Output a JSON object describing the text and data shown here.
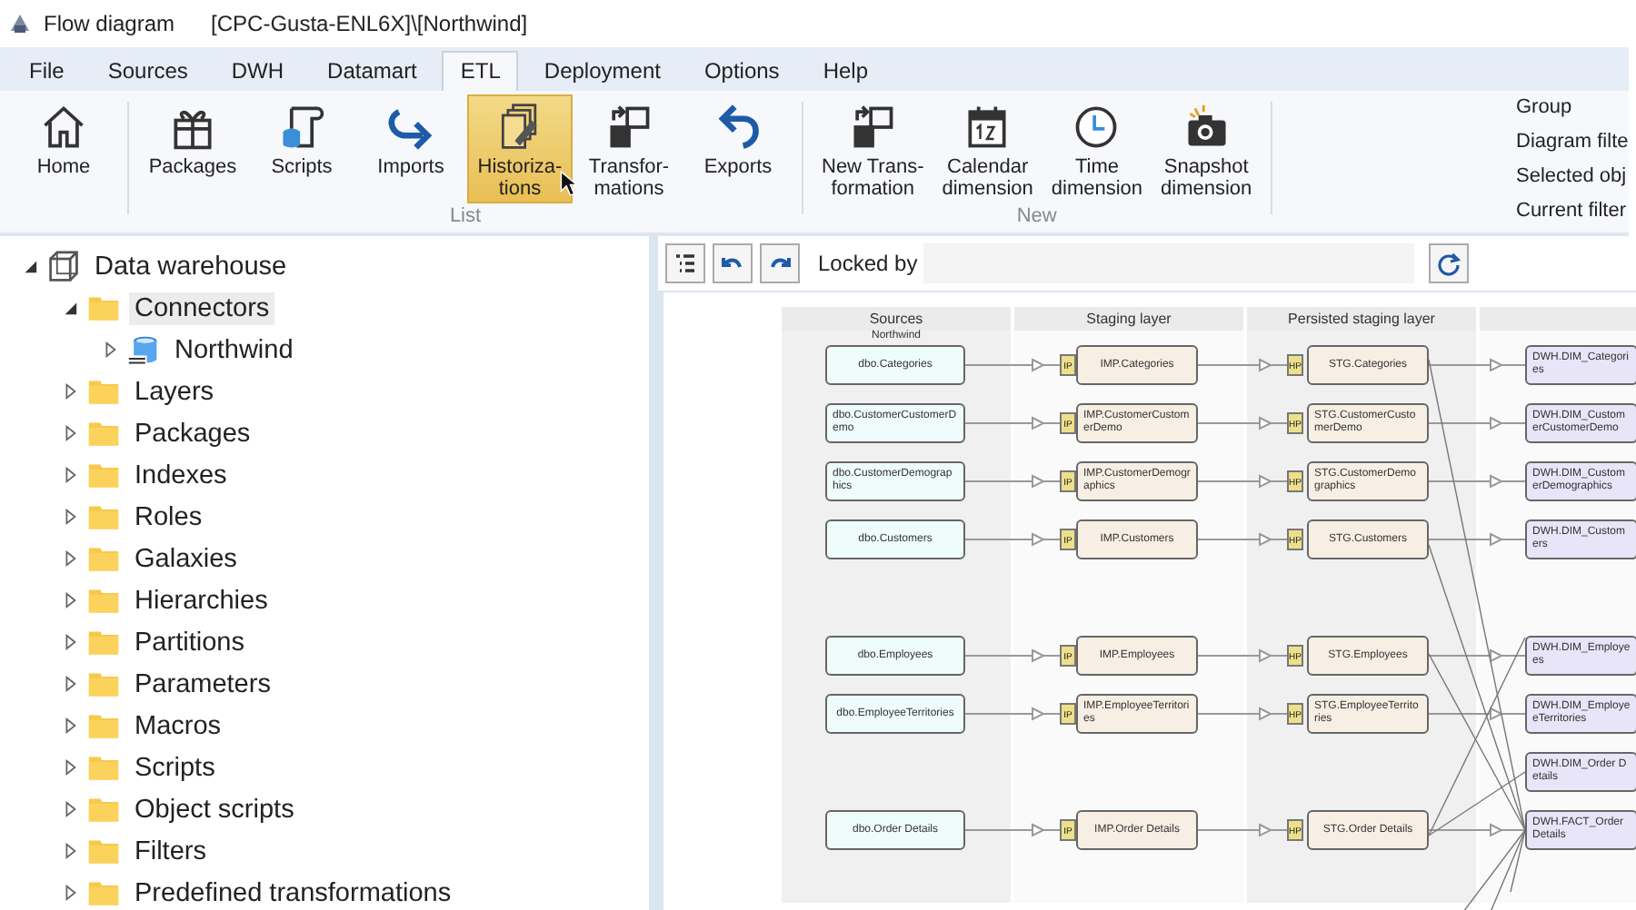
{
  "window": {
    "title": "Flow diagram",
    "path": "[CPC-Gusta-ENL6X]\\[Northwind]"
  },
  "menu": [
    {
      "label": "File",
      "selected": false
    },
    {
      "label": "Sources",
      "selected": false
    },
    {
      "label": "DWH",
      "selected": false
    },
    {
      "label": "Datamart",
      "selected": false
    },
    {
      "label": "ETL",
      "selected": true
    },
    {
      "label": "Deployment",
      "selected": false
    },
    {
      "label": "Options",
      "selected": false
    },
    {
      "label": "Help",
      "selected": false
    }
  ],
  "ribbon": {
    "groups": [
      {
        "buttons": [
          {
            "kind": "home",
            "lines": [
              "Home"
            ],
            "highlighted": false
          }
        ]
      },
      {
        "label": "List",
        "buttons": [
          {
            "kind": "packages",
            "lines": [
              "Packages"
            ],
            "highlighted": false
          },
          {
            "kind": "scripts",
            "lines": [
              "Scripts"
            ],
            "highlighted": false
          },
          {
            "kind": "imports",
            "lines": [
              "Imports"
            ],
            "highlighted": false
          },
          {
            "kind": "historizations",
            "lines": [
              "Historiza-",
              "tions"
            ],
            "highlighted": true
          },
          {
            "kind": "transformations",
            "lines": [
              "Transfor-",
              "mations"
            ],
            "highlighted": false
          },
          {
            "kind": "exports",
            "lines": [
              "Exports"
            ],
            "highlighted": false
          }
        ]
      },
      {
        "label": "New",
        "buttons": [
          {
            "kind": "transformations",
            "lines": [
              "New Trans-",
              "formation"
            ],
            "highlighted": false
          },
          {
            "kind": "calendar",
            "lines": [
              "Calendar",
              "dimension"
            ],
            "highlighted": false
          },
          {
            "kind": "time",
            "lines": [
              "Time",
              "dimension"
            ],
            "highlighted": false
          },
          {
            "kind": "snapshot",
            "lines": [
              "Snapshot",
              "dimension"
            ],
            "highlighted": false
          }
        ]
      }
    ],
    "options": [
      "Group",
      "Diagram filte",
      "Selected obj",
      "Current filter"
    ]
  },
  "tree": {
    "label": "Data warehouse",
    "kind": "warehouse",
    "expanded": true,
    "selected": false,
    "children": [
      {
        "label": "Connectors",
        "kind": "folder",
        "expanded": true,
        "selected": true,
        "children": [
          {
            "label": "Northwind",
            "kind": "database",
            "expanded": false,
            "selected": false
          }
        ]
      },
      {
        "label": "Layers",
        "kind": "folder",
        "expanded": false,
        "selected": false
      },
      {
        "label": "Packages",
        "kind": "folder",
        "expanded": false,
        "selected": false
      },
      {
        "label": "Indexes",
        "kind": "folder",
        "expanded": false,
        "selected": false
      },
      {
        "label": "Roles",
        "kind": "folder",
        "expanded": false,
        "selected": false
      },
      {
        "label": "Galaxies",
        "kind": "folder",
        "expanded": false,
        "selected": false
      },
      {
        "label": "Hierarchies",
        "kind": "folder",
        "expanded": false,
        "selected": false
      },
      {
        "label": "Partitions",
        "kind": "folder",
        "expanded": false,
        "selected": false
      },
      {
        "label": "Parameters",
        "kind": "folder",
        "expanded": false,
        "selected": false
      },
      {
        "label": "Macros",
        "kind": "folder",
        "expanded": false,
        "selected": false
      },
      {
        "label": "Scripts",
        "kind": "folder",
        "expanded": false,
        "selected": false
      },
      {
        "label": "Object scripts",
        "kind": "folder",
        "expanded": false,
        "selected": false
      },
      {
        "label": "Filters",
        "kind": "folder",
        "expanded": false,
        "selected": false
      },
      {
        "label": "Predefined transformations",
        "kind": "folder",
        "expanded": false,
        "selected": false
      }
    ]
  },
  "diagram_toolbar": {
    "locked_by_label": "Locked by"
  },
  "diagram": {
    "columns": [
      "Sources",
      "Staging layer",
      "Persisted staging layer"
    ],
    "source_group": "Northwind",
    "rows": [
      {
        "source": "dbo.Categories",
        "import_badge": "IP",
        "staging": "IMP.Categories",
        "hist_badge": "HP",
        "persisted": "STG.Categories",
        "target": "DWH.DIM_Categories"
      },
      {
        "source": "dbo.CustomerCustomerDemo",
        "import_badge": "IP",
        "staging": "IMP.CustomerCustomerDemo",
        "hist_badge": "HP",
        "persisted": "STG.CustomerCustomerDemo",
        "target": "DWH.DIM_CustomerCustomerDemo"
      },
      {
        "source": "dbo.CustomerDemographics",
        "import_badge": "IP",
        "staging": "IMP.CustomerDemographics",
        "hist_badge": "HP",
        "persisted": "STG.CustomerDemographics",
        "target": "DWH.DIM_CustomerDemographics"
      },
      {
        "source": "dbo.Customers",
        "import_badge": "IP",
        "staging": "IMP.Customers",
        "hist_badge": "HP",
        "persisted": "STG.Customers",
        "target": "DWH.DIM_Customers"
      },
      {
        "source": "dbo.Employees",
        "import_badge": "IP",
        "staging": "IMP.Employees",
        "hist_badge": "HP",
        "persisted": "STG.Employees",
        "target": "DWH.DIM_Employees"
      },
      {
        "source": "dbo.EmployeeTerritories",
        "import_badge": "IP",
        "staging": "IMP.EmployeeTerritories",
        "hist_badge": "HP",
        "persisted": "STG.EmployeeTerritories",
        "target": "DWH.DIM_EmployeeTerritories"
      },
      {
        "source": "dbo.Order Details",
        "import_badge": "IP",
        "staging": "IMP.Order Details",
        "hist_badge": "HP",
        "persisted": "STG.Order Details",
        "target": "DWH.FACT_Order Details"
      }
    ],
    "extra_targets": [
      "DWH.DIM_Order Details"
    ]
  }
}
